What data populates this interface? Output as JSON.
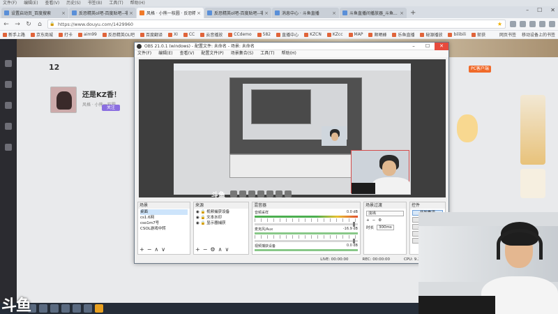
{
  "menubar": [
    "文件(F)",
    "编辑(E)",
    "查看(V)",
    "历史(S)",
    "书签(B)",
    "工具(T)",
    "帮助(H)"
  ],
  "tabs": [
    {
      "label": "设置启动页_百度搜索",
      "active": false
    },
    {
      "label": "反恐精英ol吧-百度贴吧--非...",
      "active": false
    },
    {
      "label": "风格 · 小熊一枝圆 · 反恐精英...",
      "active": true
    },
    {
      "label": "反恐精英ol吧-百度贴吧--非...",
      "active": false
    },
    {
      "label": "消息中心 · 斗鱼直播",
      "active": false
    },
    {
      "label": "斗鱼直播间播放器_斗鱼...",
      "active": false
    }
  ],
  "address_url": "https://www.douyu.com/1429960",
  "bookmarks": [
    "新手上路",
    "京东商城",
    "打卡",
    "aim99",
    "反恐精英OL吧",
    "百度翻译",
    "XI",
    "CC",
    "云音播放",
    "CCdemo",
    "582",
    "直播中心",
    "KZCN",
    "KZcc",
    "MAP",
    "顺晒蜂",
    "乐鱼直播",
    "秘源播放",
    "bilibili",
    "斩获"
  ],
  "bookmarks_right": [
    "网页书签",
    "移动设备上的书签"
  ],
  "page": {
    "level_number": "12",
    "streamer_name": "还是KZ香！",
    "streamer_meta": "风格  ·  小熊一枝圆",
    "follow_label": "关注",
    "pc_button": "PC客户端"
  },
  "obs": {
    "title": "OBS 21.0.1 (windows) - 配置文件: 未命名 - 场景: 未命名",
    "menu": [
      "文件(F)",
      "编辑(E)",
      "查看(V)",
      "配置文件(P)",
      "场景集合(S)",
      "工具(T)",
      "帮助(H)"
    ],
    "scenes_header": "场景",
    "scenes": [
      "桌面",
      "cs1.6网",
      "cso1m7号",
      "CSOL游戏中转"
    ],
    "sources_header": "来源",
    "sources": [
      "视频捕获设备",
      "文本水印",
      "显示器捕获"
    ],
    "mixer_header": "混音器",
    "mixer": [
      {
        "name": "音频采样",
        "db": "0.0 dB"
      },
      {
        "name": "麦克风/Aux",
        "db": "-16.9 dB"
      },
      {
        "name": "视频捕获设备",
        "db": "0.0 dB"
      }
    ],
    "transitions_header": "场景过渡",
    "transition_value": "淡出",
    "duration_label": "时长",
    "duration_value": "300ms",
    "controls_header": "控件",
    "controls": [
      "开始推流",
      "开始录制",
      "工作室模式",
      "设置",
      "退出"
    ],
    "status": [
      "LIVE: 00:00:00",
      "REC: 00:00:00",
      "CPU: 9.2%, 29.97 fps"
    ]
  },
  "preview_logo": "斗鱼",
  "corner_logo": "斗鱼"
}
